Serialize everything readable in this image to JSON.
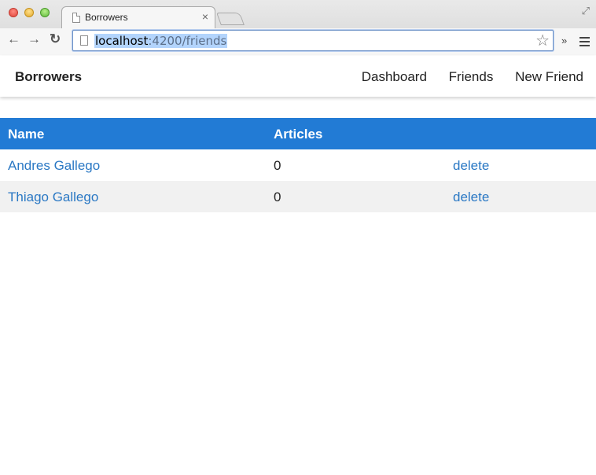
{
  "browser": {
    "tab_title": "Borrowers",
    "url_host": "localhost",
    "url_path": ":4200/friends",
    "close_glyph": "×",
    "overflow_glyph": "»"
  },
  "app": {
    "brand": "Borrowers",
    "nav": [
      {
        "label": "Dashboard"
      },
      {
        "label": "Friends"
      },
      {
        "label": "New Friend"
      }
    ]
  },
  "table": {
    "headers": {
      "name": "Name",
      "articles": "Articles"
    },
    "rows": [
      {
        "name": "Andres Gallego",
        "articles": "0",
        "action": "delete"
      },
      {
        "name": "Thiago Gallego",
        "articles": "0",
        "action": "delete"
      }
    ]
  },
  "colors": {
    "header_bg": "#227bd5",
    "link": "#2a78c4",
    "alt_row": "#f1f1f1"
  }
}
